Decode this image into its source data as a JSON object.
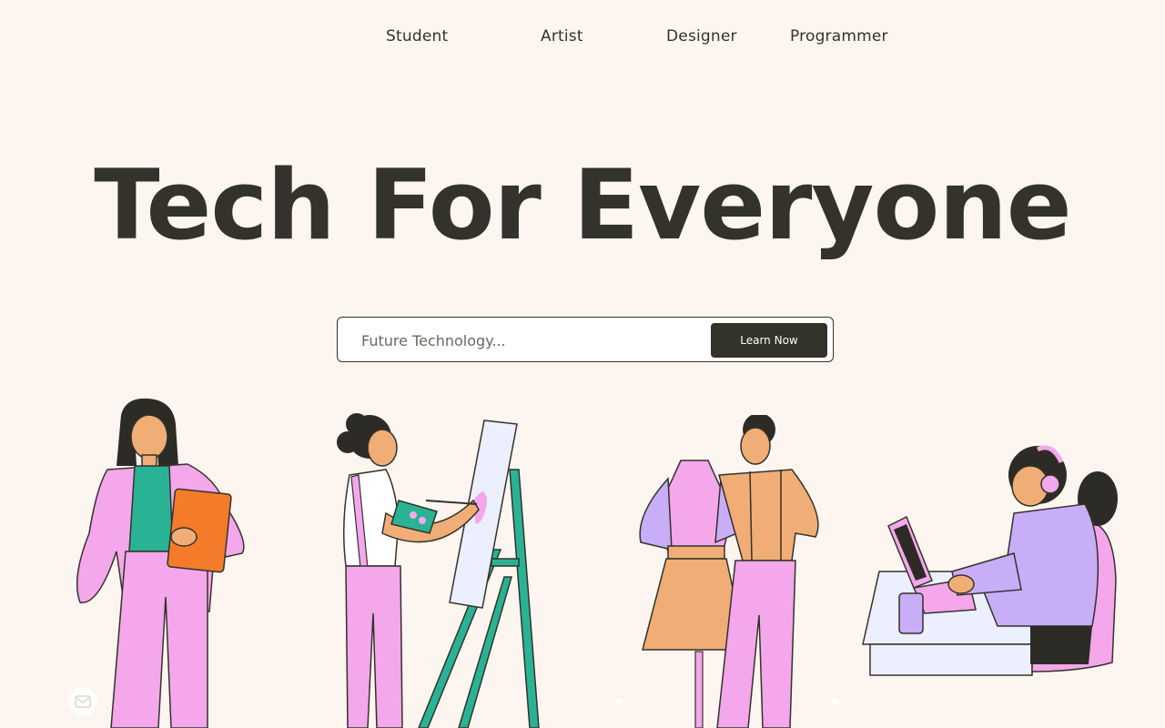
{
  "nav": {
    "items": [
      {
        "label": "Student"
      },
      {
        "label": "Artist"
      },
      {
        "label": "Designer"
      },
      {
        "label": "Programmer"
      }
    ]
  },
  "hero": {
    "title": "Tech For Everyone"
  },
  "search": {
    "placeholder": "Future Technology...",
    "button_label": "Learn Now"
  },
  "colors": {
    "background": "#fdf6f0",
    "text": "#33322b",
    "pink": "#f4a7ea",
    "teal": "#29b394",
    "orange": "#f47b2a",
    "lavender": "#c8adf7",
    "tan": "#f0ad75"
  },
  "illustrations": [
    {
      "icon": "student-figure-icon"
    },
    {
      "icon": "artist-figure-icon"
    },
    {
      "icon": "designer-figure-icon"
    },
    {
      "icon": "programmer-figure-icon"
    }
  ]
}
